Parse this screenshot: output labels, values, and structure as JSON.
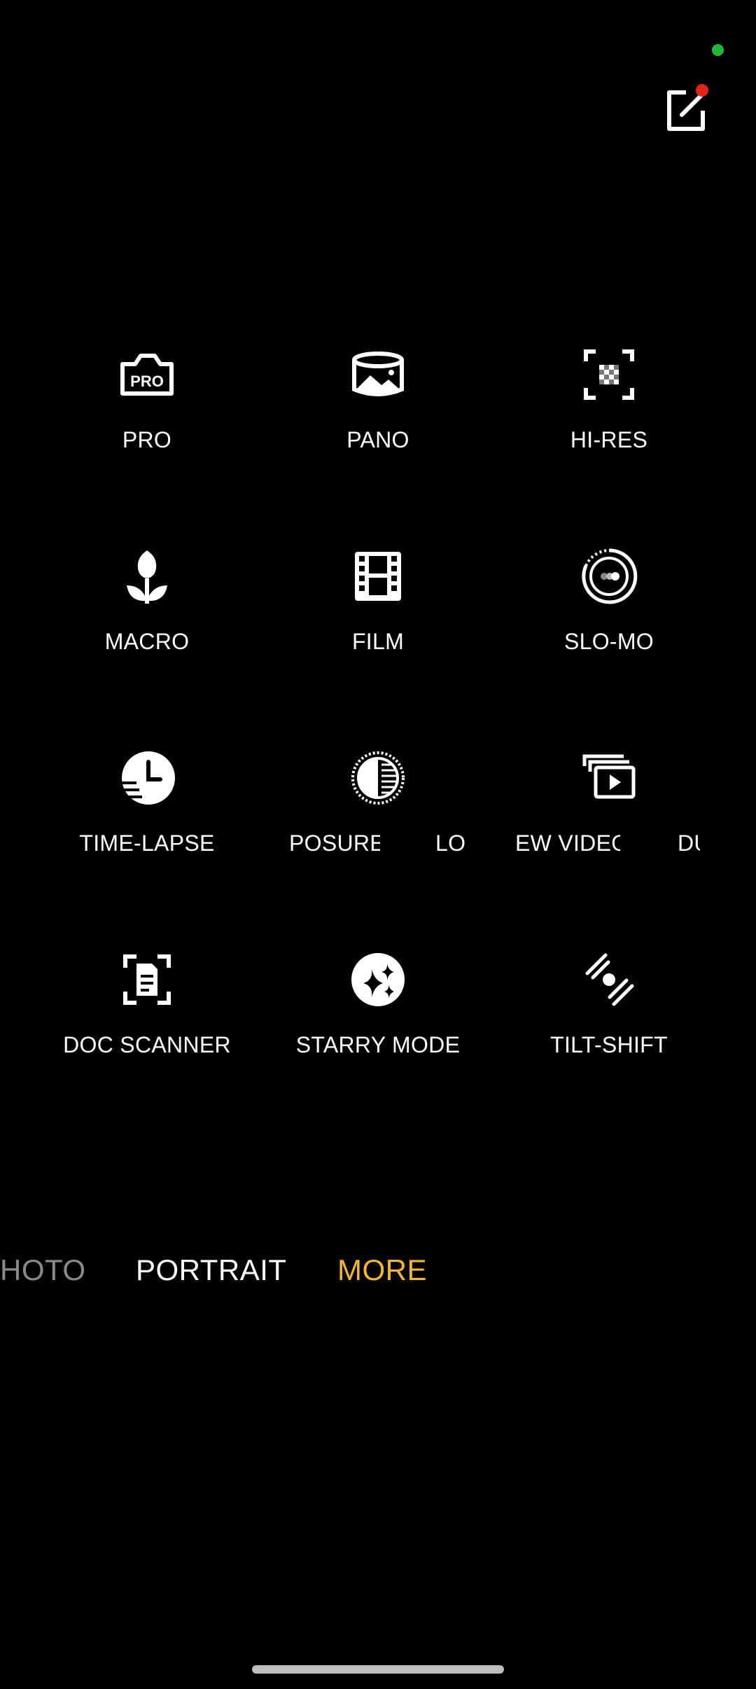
{
  "colors": {
    "background": "#000000",
    "text": "#ffffff",
    "accent": "#f4b62e",
    "status_dot": "#1fb83a",
    "badge": "#e0251b"
  },
  "header": {
    "edit_icon": "edit-square-icon"
  },
  "modes": [
    {
      "label": "PRO",
      "icon": "pro-camera-icon"
    },
    {
      "label": "PANO",
      "icon": "panorama-icon"
    },
    {
      "label": "HI-RES",
      "icon": "hi-res-icon"
    },
    {
      "label": "MACRO",
      "icon": "tulip-icon"
    },
    {
      "label": "FILM",
      "icon": "film-icon"
    },
    {
      "label": "SLO-MO",
      "icon": "slow-motion-icon"
    },
    {
      "label": "TIME-LAPSE",
      "icon": "clock-icon"
    },
    {
      "label": "POSURE",
      "icon": "exposure-icon"
    },
    {
      "label": "LO",
      "icon": ""
    },
    {
      "label": "EW VIDEO",
      "icon": "video-playlist-icon"
    },
    {
      "label": "DU",
      "icon": ""
    },
    {
      "label": "DOC SCANNER",
      "icon": "document-scan-icon"
    },
    {
      "label": "STARRY MODE",
      "icon": "sparkle-icon"
    },
    {
      "label": "TILT-SHIFT",
      "icon": "tilt-shift-icon"
    }
  ],
  "carousel": {
    "items": [
      {
        "label": "HOTO",
        "active": false
      },
      {
        "label": "PORTRAIT",
        "active": false
      },
      {
        "label": "MORE",
        "active": true
      }
    ]
  }
}
